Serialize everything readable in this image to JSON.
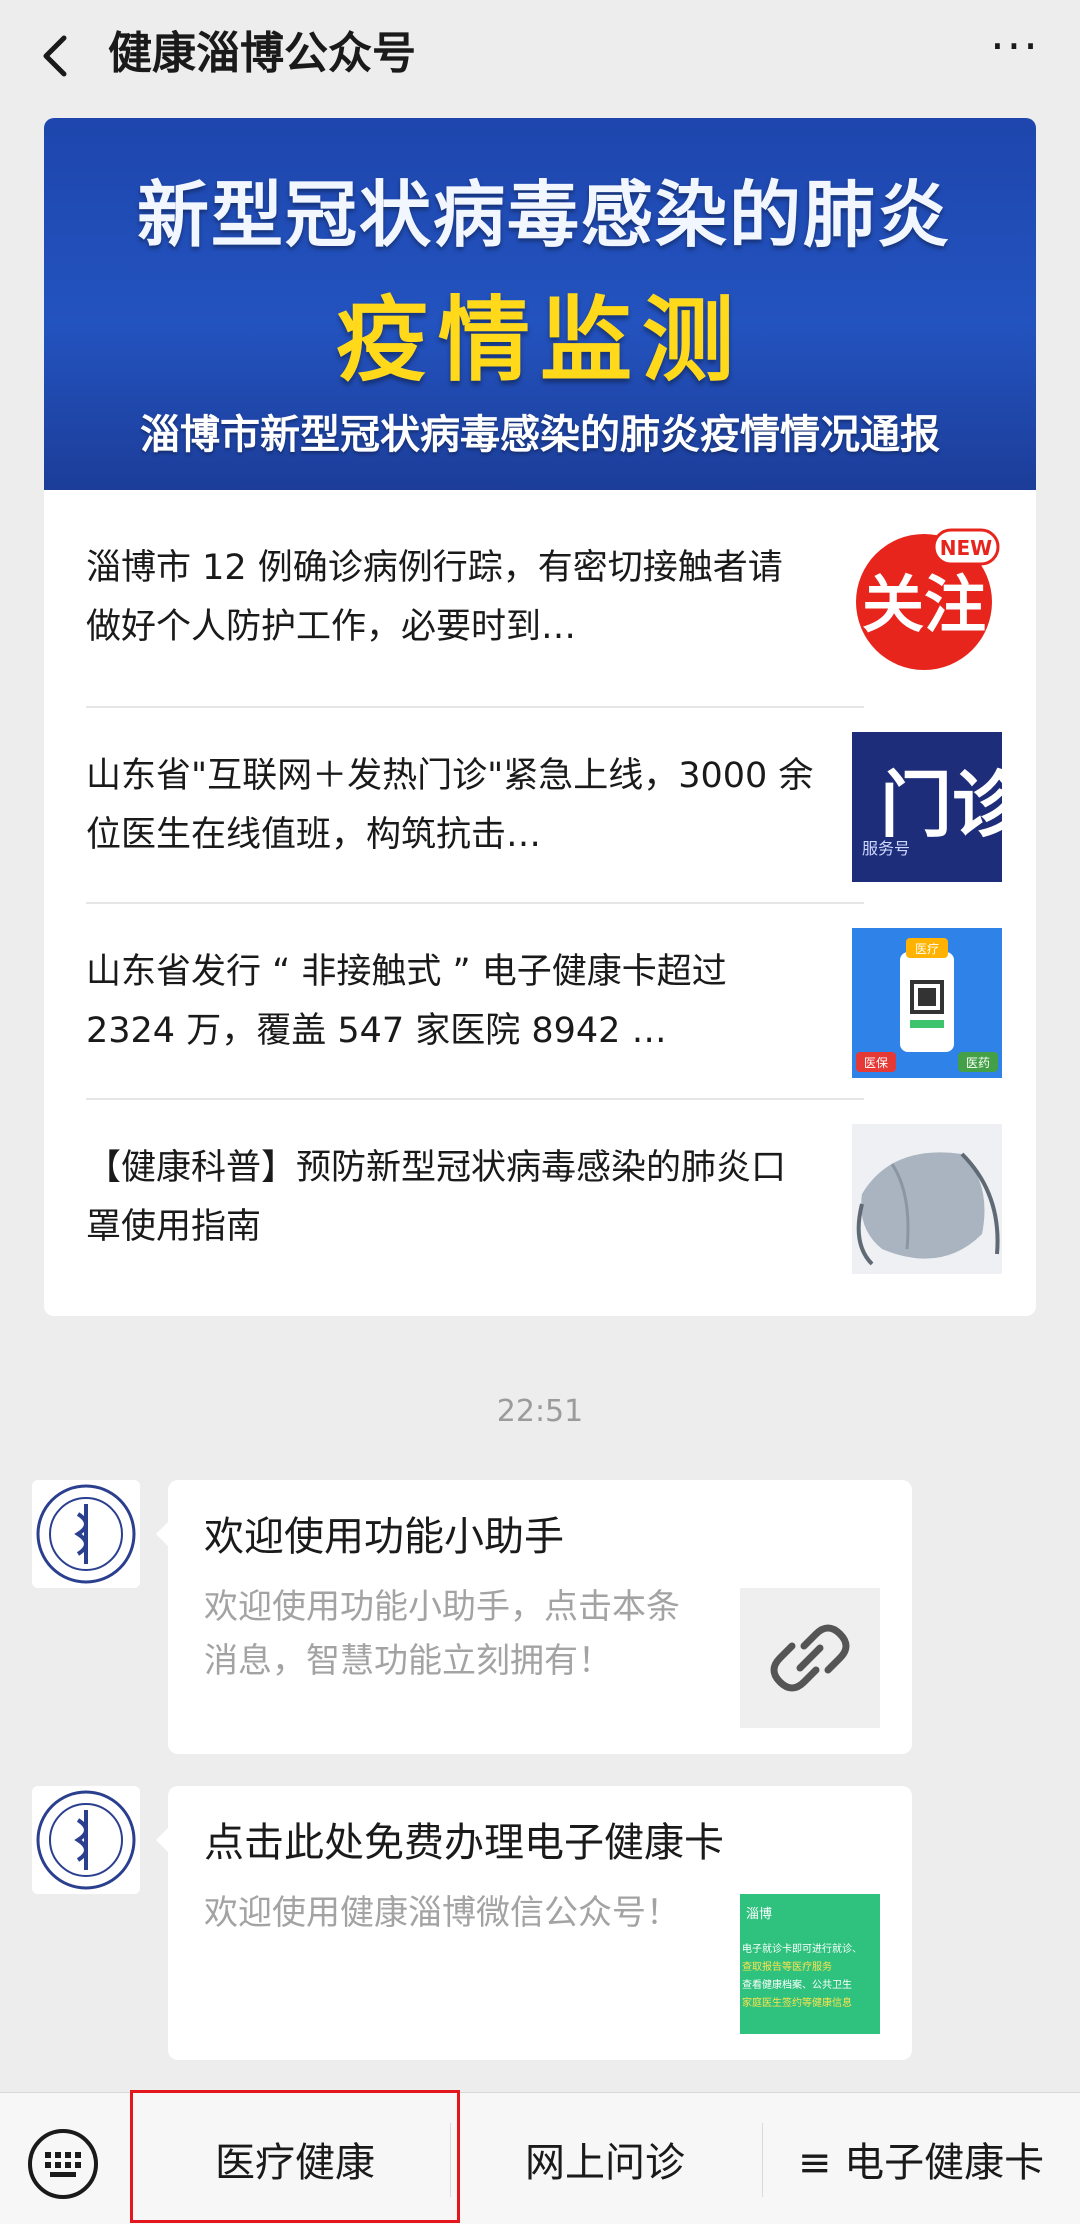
{
  "header": {
    "title": "健康淄博公众号",
    "more": "···"
  },
  "banner": {
    "line1": "新型冠状病毒感染的肺炎",
    "line2": "疫情监测",
    "line3": "淄博市新型冠状病毒感染的肺炎疫情情况通报"
  },
  "articles": [
    {
      "title": "淄博市 12 例确诊病例行踪，有密切接触者请做好个人防护工作，必要时到…",
      "thumb_text": "关注",
      "thumb_badge": "NEW"
    },
    {
      "title": "山东省\"互联网＋发热门诊\"紧急上线，3000 余位医生在线值班，构筑抗击…",
      "thumb_text": "门诊",
      "thumb_sub": "服务号"
    },
    {
      "title": "山东省发行 “ 非接触式 ” 电子健康卡超过 2324 万，覆盖 547 家医院 8942 …",
      "thumb_tags": [
        "医疗",
        "医保",
        "医药"
      ]
    },
    {
      "title": "【健康科普】预防新型冠状病毒感染的肺炎口罩使用指南"
    }
  ],
  "time": "22:51",
  "messages": [
    {
      "title": "欢迎使用功能小助手",
      "desc": "欢迎使用功能小助手，点击本条消息，智慧功能立刻拥有！"
    },
    {
      "title": "点击此处免费办理电子健康卡",
      "desc": "欢迎使用健康淄博微信公众号！",
      "thumb_lines": [
        "淄博",
        "电子就诊卡即可进行就诊、",
        "查取报告等医疗服务",
        "查看健康档案、公共卫生",
        "家庭医生签约等健康信息"
      ]
    }
  ],
  "menu": {
    "items": [
      "医疗健康",
      "网上问诊",
      "≡ 电子健康卡"
    ]
  },
  "colors": {
    "accent_red": "#e3161e",
    "banner_blue": "#2353bf",
    "banner_yellow": "#ffd91a"
  }
}
